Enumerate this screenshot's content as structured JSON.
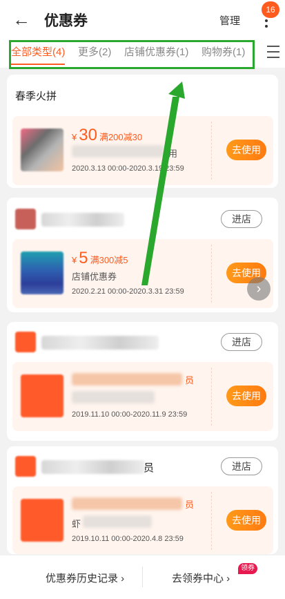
{
  "header": {
    "title": "优惠券",
    "manage_label": "管理",
    "badge_count": "16",
    "back_icon": "←"
  },
  "tabs": [
    {
      "label": "全部类型(4)"
    },
    {
      "label": "更多(2)"
    },
    {
      "label": "店铺优惠券(1)"
    },
    {
      "label": "购物券(1)"
    }
  ],
  "cards": {
    "c0": {
      "section_title": "春季火拼",
      "currency": "¥",
      "amount": "30",
      "condition": "满200减30",
      "name_suffix": "用",
      "date": "2020.3.13 00:00-2020.3.19 23:59",
      "use_label": "去使用"
    },
    "c1": {
      "enter_label": "进店",
      "currency": "¥",
      "amount": "5",
      "condition": "满300减5",
      "type": "店铺优惠券",
      "date": "2020.2.21 00:00-2020.3.31 23:59",
      "use_label": "去使用"
    },
    "c2": {
      "enter_label": "进店",
      "name_suffix": "员",
      "date": "2019.11.10 00:00-2020.11.9 23:59",
      "use_label": "去使用"
    },
    "c3": {
      "enter_label": "进店",
      "store_suffix": "员",
      "name_suffix": "员",
      "type_prefix": "虾",
      "date": "2019.10.11 00:00-2020.4.8 23:59",
      "use_label": "去使用"
    }
  },
  "footer": {
    "history_label": "优惠券历史记录 ›",
    "center_label": "去领券中心 ›",
    "tag_label": "领券"
  },
  "colors": {
    "accent": "#ff5b1f",
    "highlight": "#2aa82e",
    "button": "#ff8a15"
  }
}
